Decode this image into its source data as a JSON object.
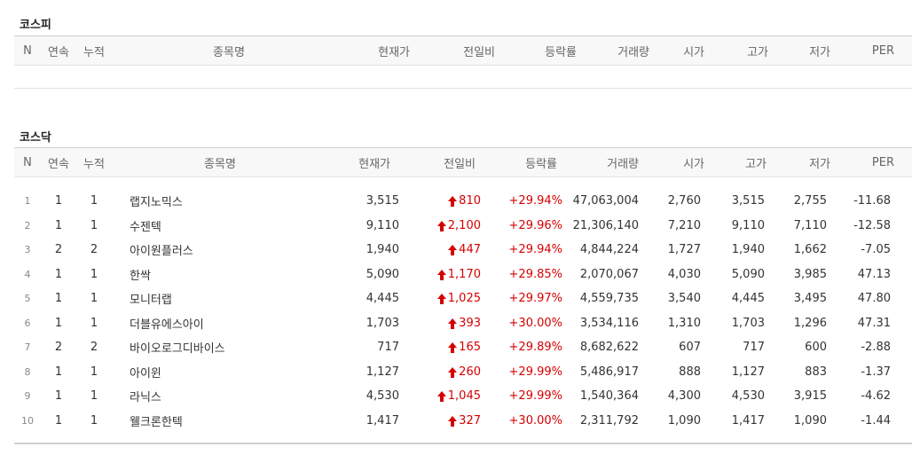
{
  "kospi": {
    "title": "코스피",
    "headers": [
      "N",
      "연속",
      "누적",
      "종목명",
      "현재가",
      "전일비",
      "등락률",
      "거래량",
      "시가",
      "고가",
      "저가",
      "PER"
    ]
  },
  "kosdaq": {
    "title": "코스닥",
    "headers": [
      "N",
      "연속",
      "누적",
      "종목명",
      "현재가",
      "전일비",
      "등락률",
      "거래량",
      "시가",
      "고가",
      "저가",
      "PER"
    ],
    "rows": [
      {
        "n": "1",
        "streak": "1",
        "cumulative": "1",
        "name": "랩지노믹스",
        "price": "3,515",
        "change": "810",
        "rate": "+29.94%",
        "volume": "47,063,004",
        "open": "2,760",
        "high": "3,515",
        "low": "2,755",
        "per": "-11.68"
      },
      {
        "n": "2",
        "streak": "1",
        "cumulative": "1",
        "name": "수젠텍",
        "price": "9,110",
        "change": "2,100",
        "rate": "+29.96%",
        "volume": "21,306,140",
        "open": "7,210",
        "high": "9,110",
        "low": "7,110",
        "per": "-12.58"
      },
      {
        "n": "3",
        "streak": "2",
        "cumulative": "2",
        "name": "아이원플러스",
        "price": "1,940",
        "change": "447",
        "rate": "+29.94%",
        "volume": "4,844,224",
        "open": "1,727",
        "high": "1,940",
        "low": "1,662",
        "per": "-7.05"
      },
      {
        "n": "4",
        "streak": "1",
        "cumulative": "1",
        "name": "한싹",
        "price": "5,090",
        "change": "1,170",
        "rate": "+29.85%",
        "volume": "2,070,067",
        "open": "4,030",
        "high": "5,090",
        "low": "3,985",
        "per": "47.13"
      },
      {
        "n": "5",
        "streak": "1",
        "cumulative": "1",
        "name": "모니터랩",
        "price": "4,445",
        "change": "1,025",
        "rate": "+29.97%",
        "volume": "4,559,735",
        "open": "3,540",
        "high": "4,445",
        "low": "3,495",
        "per": "47.80"
      },
      {
        "n": "6",
        "streak": "1",
        "cumulative": "1",
        "name": "더블유에스아이",
        "price": "1,703",
        "change": "393",
        "rate": "+30.00%",
        "volume": "3,534,116",
        "open": "1,310",
        "high": "1,703",
        "low": "1,296",
        "per": "47.31"
      },
      {
        "n": "7",
        "streak": "2",
        "cumulative": "2",
        "name": "바이오로그디바이스",
        "price": "717",
        "change": "165",
        "rate": "+29.89%",
        "volume": "8,682,622",
        "open": "607",
        "high": "717",
        "low": "600",
        "per": "-2.88"
      },
      {
        "n": "8",
        "streak": "1",
        "cumulative": "1",
        "name": "아이윈",
        "price": "1,127",
        "change": "260",
        "rate": "+29.99%",
        "volume": "5,486,917",
        "open": "888",
        "high": "1,127",
        "low": "883",
        "per": "-1.37"
      },
      {
        "n": "9",
        "streak": "1",
        "cumulative": "1",
        "name": "라닉스",
        "price": "4,530",
        "change": "1,045",
        "rate": "+29.99%",
        "volume": "1,540,364",
        "open": "4,300",
        "high": "4,530",
        "low": "3,915",
        "per": "-4.62"
      },
      {
        "n": "10",
        "streak": "1",
        "cumulative": "1",
        "name": "웰크론한텍",
        "price": "1,417",
        "change": "327",
        "rate": "+30.00%",
        "volume": "2,311,792",
        "open": "1,090",
        "high": "1,417",
        "low": "1,090",
        "per": "-1.44"
      }
    ]
  },
  "colors": {
    "up": "#d60000",
    "header_bg": "#f8f8f8",
    "border": "#cfcfcf"
  },
  "icons": {
    "change_up": "red-up-arrow-icon"
  }
}
